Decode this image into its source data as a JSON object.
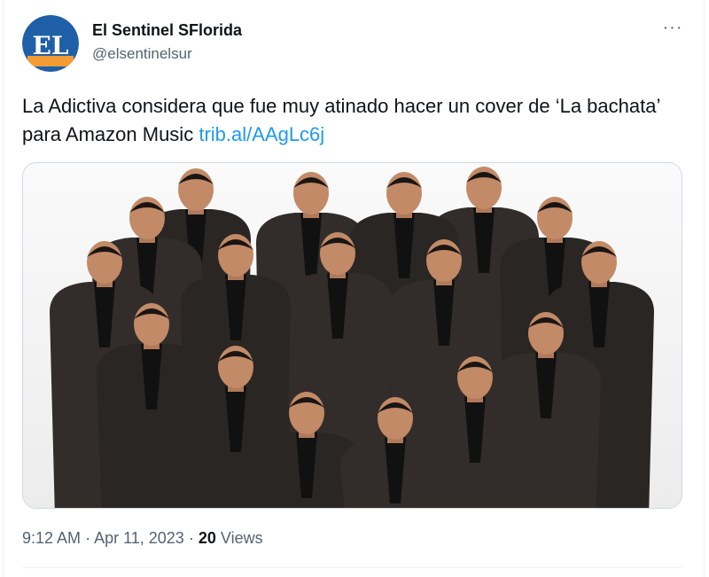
{
  "author": {
    "display_name": "El Sentinel SFlorida",
    "handle": "@elsentinelsur",
    "avatar_text": "EL"
  },
  "menu": {
    "more_label": "···"
  },
  "tweet": {
    "text": "La Adictiva considera que fue muy atinado hacer un cover de ‘La bachata’ para Amazon Music",
    "link": "trib.al/AAgLc6j"
  },
  "meta": {
    "time": "9:12 AM",
    "date": "Apr 11, 2023",
    "separator": "·",
    "views_count": "20",
    "views_label": "Views"
  },
  "colors": {
    "link": "#1d9bf0",
    "secondary_text": "#536471",
    "avatar_blue": "#1f5fa8",
    "avatar_orange": "#f39c34"
  }
}
